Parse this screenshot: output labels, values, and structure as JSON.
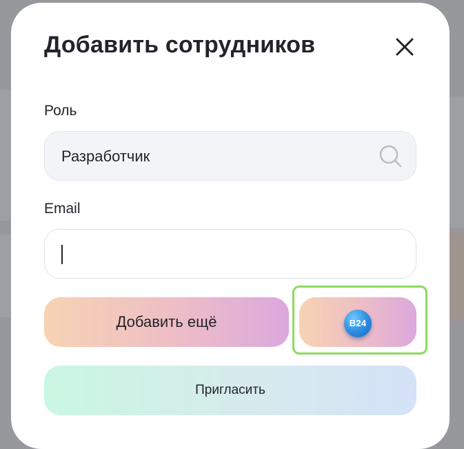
{
  "modal": {
    "title": "Добавить сотрудников",
    "close_icon": "close-icon",
    "role": {
      "label": "Роль",
      "value": "Разработчик",
      "icon": "search-icon"
    },
    "email": {
      "label": "Email",
      "value": ""
    },
    "buttons": {
      "add_more": "Добавить ещё",
      "b24_logo": "B24",
      "invite": "Пригласить"
    }
  },
  "colors": {
    "highlight_border": "#8fd95f",
    "b24_blue": "#2a8be0"
  }
}
